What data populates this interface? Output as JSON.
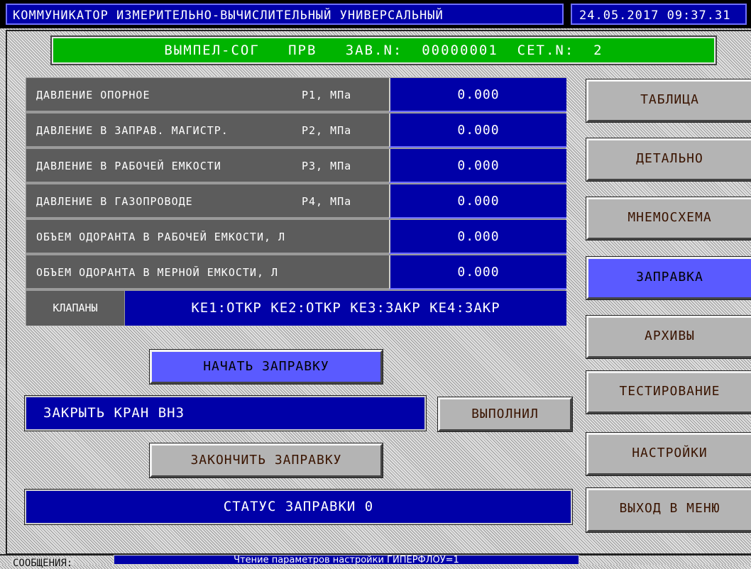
{
  "window": {
    "title": "КОММУНИКАТОР ИЗМЕРИТЕЛЬНО-ВЫЧИСЛИТЕЛЬНЫЙ УНИВЕРСАЛЬНЫЙ",
    "datetime": "24.05.2017 09:37.31"
  },
  "device": {
    "header": "ВЫМПЕЛ-СОГ   ПРВ   ЗАВ.N:  00000001  СЕТ.N:  2"
  },
  "params": [
    {
      "label": "ДАВЛЕНИЕ ОПОРНОЕ",
      "unit": "P1, МПа",
      "value": "0.000"
    },
    {
      "label": "ДАВЛЕНИЕ В ЗАПРАВ. МАГИСТР.",
      "unit": "P2, МПа",
      "value": "0.000"
    },
    {
      "label": "ДАВЛЕНИЕ В РАБОЧЕЙ ЕМКОСТИ",
      "unit": "P3, МПа",
      "value": "0.000"
    },
    {
      "label": "ДАВЛЕНИЕ В ГАЗОПРОВОДЕ",
      "unit": "P4, МПа",
      "value": "0.000"
    },
    {
      "label": "ОБЪЕМ ОДОРАНТА В РАБОЧЕЙ ЕМКОСТИ, Л",
      "unit": "",
      "value": "0.000"
    },
    {
      "label": "ОБЪЕМ ОДОРАНТА В МЕРНОЙ ЕМКОСТИ, Л",
      "unit": "",
      "value": "0.000"
    }
  ],
  "valves": {
    "label": "КЛАПАНЫ",
    "value": "КЕ1:ОТКР КЕ2:ОТКР КЕ3:ЗАКР КЕ4:ЗАКР"
  },
  "actions": {
    "start": "НАЧАТЬ ЗАПРАВКУ",
    "instruction": "ЗАКРЫТЬ КРАН ВНЗ",
    "done": "ВЫПОЛНИЛ",
    "finish": "ЗАКОНЧИТЬ ЗАПРАВКУ",
    "status": "СТАТУС ЗАПРАВКИ 0"
  },
  "sidebar": {
    "items": [
      {
        "label": "ТАБЛИЦА",
        "active": false
      },
      {
        "label": "ДЕТАЛЬНО",
        "active": false
      },
      {
        "label": "МНЕМОСХЕМА",
        "active": false
      },
      {
        "label": "ЗАПРАВКА",
        "active": true
      },
      {
        "label": "АРХИВЫ",
        "active": false
      },
      {
        "label": "ТЕСТИРОВАНИЕ",
        "active": false
      },
      {
        "label": "НАСТРОЙКИ",
        "active": false
      },
      {
        "label": "ВЫХОД В МЕНЮ",
        "active": false
      }
    ]
  },
  "messages": {
    "label": "СООБЩЕНИЯ:",
    "text": "Чтение параметров настройки ГИПЕРФЛОУ=1"
  },
  "colors": {
    "panel_blue": "#0000a8",
    "header_green": "#00b400",
    "active_button": "#5a5aff",
    "label_gray": "#5c5c5c"
  }
}
